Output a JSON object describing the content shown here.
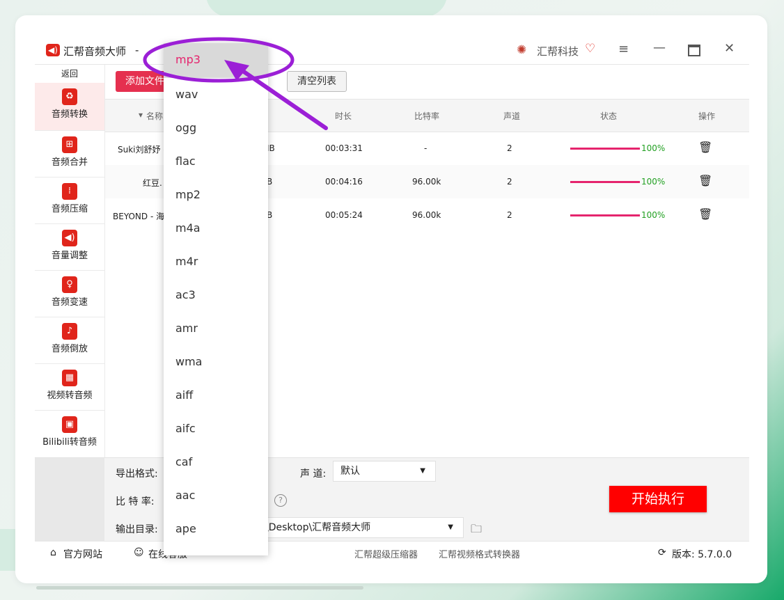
{
  "window": {
    "app_title": "汇帮音频大师",
    "title_sep": "-",
    "brand_name": "汇帮科技"
  },
  "sidebar": {
    "back_label": "返回",
    "items": [
      {
        "label": "音频转换",
        "icon": "audio-convert-icon"
      },
      {
        "label": "音频合并",
        "icon": "audio-merge-icon"
      },
      {
        "label": "音频压缩",
        "icon": "audio-compress-icon"
      },
      {
        "label": "音量调整",
        "icon": "volume-icon"
      },
      {
        "label": "音频变速",
        "icon": "mic-icon"
      },
      {
        "label": "音频倒放",
        "icon": "music-note-icon"
      },
      {
        "label": "视频转音频",
        "icon": "film-icon"
      },
      {
        "label": "Bilibili转音频",
        "icon": "tv-icon"
      }
    ]
  },
  "toolbar": {
    "add_label": "添加文件",
    "clear_label": "清空列表"
  },
  "table": {
    "headers": {
      "name": "名称",
      "duration": "时长",
      "bitrate": "比特率",
      "channels": "声道",
      "status": "状态",
      "action": "操作"
    },
    "rows": [
      {
        "name": "Suki刘舒妤 -",
        "size": "IB",
        "duration": "00:03:31",
        "bitrate": "-",
        "channels": "2",
        "status": "100%"
      },
      {
        "name": "红豆.",
        "size": "B",
        "duration": "00:04:16",
        "bitrate": "96.00k",
        "channels": "2",
        "status": "100%"
      },
      {
        "name": "BEYOND - 海",
        "size": "B",
        "duration": "00:05:24",
        "bitrate": "96.00k",
        "channels": "2",
        "status": "100%"
      }
    ],
    "progress_fraction": 1.0
  },
  "settings": {
    "format_label": "导出格式:",
    "channel_label": "声 道:",
    "channel_value": "默认",
    "bitrate_label": "比 特 率:",
    "output_label": "输出目录:",
    "output_value": "\\Desktop\\汇帮音频大师",
    "help_glyph": "?",
    "start_label": "开始执行"
  },
  "footer": {
    "website": "官方网站",
    "online": "在线客服",
    "link1": "汇帮超级压缩器",
    "link2": "汇帮视频格式转换器",
    "version": "版本: 5.7.0.0"
  },
  "format_dropdown": {
    "selected": "mp3",
    "options": [
      "mp3",
      "wav",
      "ogg",
      "flac",
      "mp2",
      "m4a",
      "m4r",
      "ac3",
      "amr",
      "wma",
      "aiff",
      "aifc",
      "caf",
      "aac",
      "ape"
    ]
  },
  "colors": {
    "accent": "#e5246d",
    "brand_red": "#e0251b",
    "annotation": "#9b1fd6",
    "success": "#22a022"
  }
}
